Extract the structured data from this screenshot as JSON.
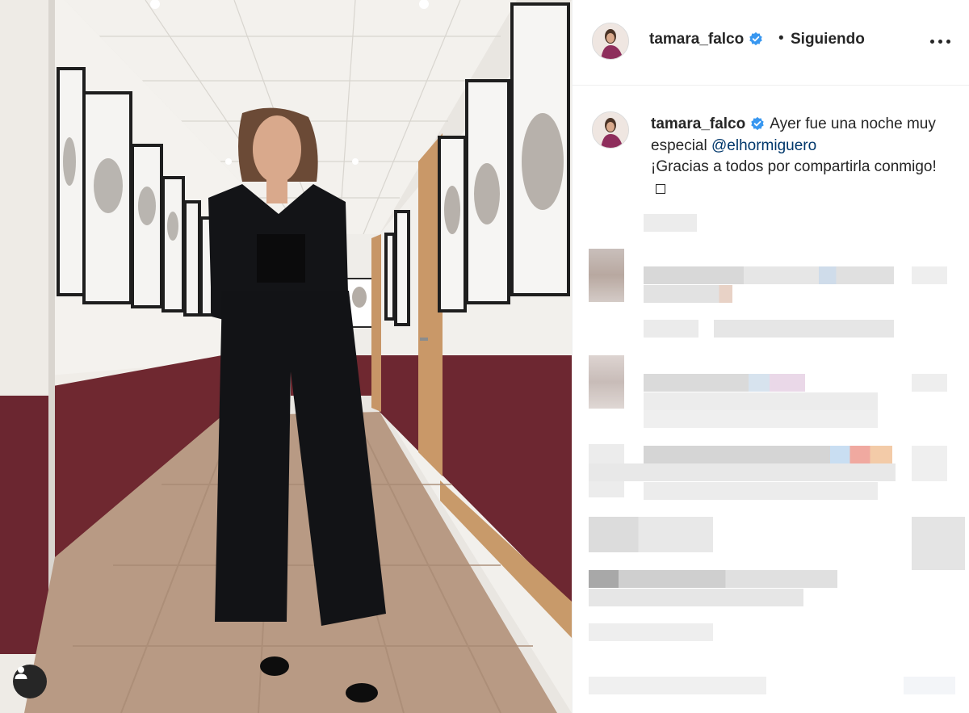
{
  "post": {
    "username": "tamara_falco",
    "separator": "•",
    "follow_status": "Siguiendo",
    "caption": {
      "username": "tamara_falco",
      "text_before": "Ayer fue una noche muy especial",
      "mention": "@elhormiguero",
      "text_after": "¡Gracias a todos por compartirla conmigo!"
    }
  },
  "icons": {
    "verified": "verified-badge-icon",
    "more": "more-options-icon",
    "user_tag": "user-tag-icon"
  },
  "colors": {
    "verified_blue": "#3897f0",
    "mention_blue": "#00376b",
    "text": "#262626"
  }
}
